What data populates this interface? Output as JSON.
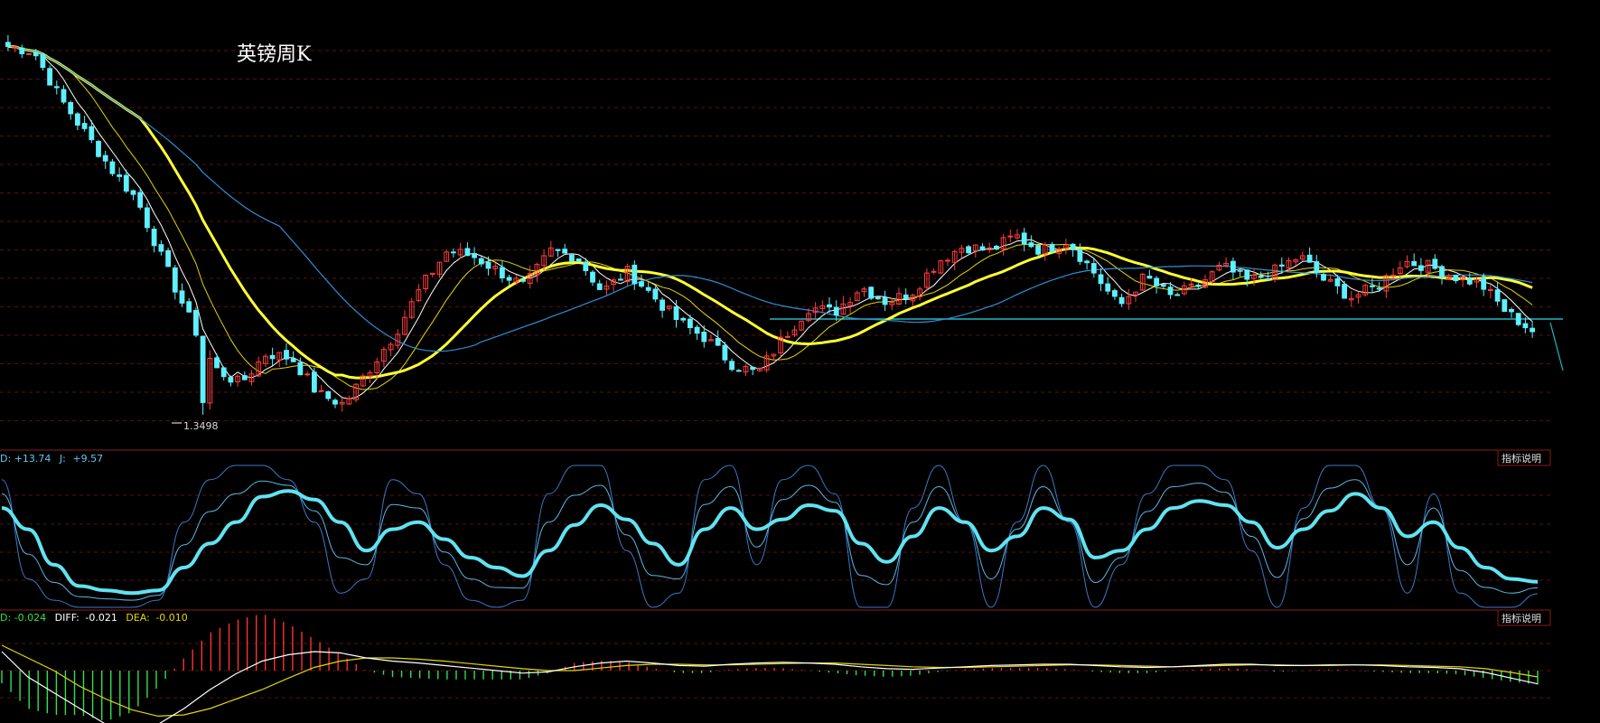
{
  "chart_title": "英镑周K",
  "low_marker": "1.3498",
  "colors": {
    "background": "#000000",
    "grid": "#5a0f0f",
    "panel_border": "#8b1b1b",
    "up": "#ff3d3d",
    "down": "#5ff0ff",
    "ma_white": "#ffffff",
    "ma_yellow_thin": "#e6d600",
    "ma_yellow_thick": "#ffff33",
    "ma_blue": "#2e8fd6",
    "support": "#20b7c6",
    "kdj_k": "#61e3f0",
    "kdj_d": "#5ab7e6",
    "kdj_j": "#3a79c4",
    "macd_diff": "#ffffff",
    "macd_dea": "#e6d600",
    "macd_pos": "#ff3030",
    "macd_neg": "#31e04d"
  },
  "kdj_header": {
    "d_label": "D:",
    "d_value": "+13.74",
    "j_label": "J:",
    "j_value": "+9.57"
  },
  "macd_header": {
    "macd_label": "D:",
    "macd_value": "-0.024",
    "diff_label": "DIFF:",
    "diff_value": "-0.021",
    "dea_label": "DEA:",
    "dea_value": "-0.010"
  },
  "buttons": {
    "kdj_explain": "指标说明",
    "macd_explain": "指标说明"
  },
  "chart_data": [
    {
      "type": "candlestick",
      "title": "英镑周K",
      "series_anchor_closes": [
        1.71,
        1.705,
        1.66,
        1.625,
        1.59,
        1.56,
        1.5,
        1.445,
        1.395,
        1.38,
        1.41,
        1.405,
        1.37,
        1.36,
        1.395,
        1.43,
        1.475,
        1.51,
        1.505,
        1.49,
        1.475,
        1.51,
        1.505,
        1.47,
        1.49,
        1.465,
        1.44,
        1.425,
        1.4,
        1.39,
        1.425,
        1.455,
        1.45,
        1.475,
        1.46,
        1.47,
        1.5,
        1.515,
        1.51,
        1.525,
        1.51,
        1.52,
        1.49,
        1.455,
        1.485,
        1.465,
        1.475,
        1.495,
        1.48,
        1.49,
        1.505,
        1.48,
        1.465,
        1.475,
        1.5,
        1.495,
        1.485,
        1.478,
        1.45,
        1.432
      ],
      "price_levels": {
        "low_marker": 1.3498,
        "support_line": 1.452
      },
      "moving_averages": [
        "white",
        "yellow-thin",
        "yellow-thick",
        "blue"
      ]
    },
    {
      "type": "line",
      "indicator": "KDJ",
      "series": [
        {
          "name": "D",
          "values": [
            70,
            55,
            30,
            15,
            12,
            10,
            12,
            28,
            45,
            60,
            78,
            82,
            76,
            60,
            40,
            55,
            60,
            48,
            35,
            28,
            22,
            40,
            58,
            72,
            62,
            45,
            30,
            55,
            70,
            55,
            62,
            72,
            68,
            45,
            32,
            50,
            70,
            60,
            40,
            50,
            70,
            62,
            35,
            40,
            55,
            70,
            75,
            72,
            60,
            42,
            55,
            68,
            80,
            70,
            50,
            60,
            42,
            28,
            20,
            18
          ]
        },
        {
          "name": "J",
          "values": [
            90,
            20,
            5,
            0,
            0,
            0,
            5,
            60,
            90,
            100,
            100,
            90,
            60,
            10,
            20,
            90,
            80,
            30,
            5,
            0,
            5,
            80,
            100,
            100,
            40,
            0,
            10,
            90,
            100,
            30,
            90,
            100,
            80,
            0,
            0,
            70,
            100,
            60,
            0,
            60,
            100,
            60,
            0,
            30,
            80,
            100,
            100,
            90,
            40,
            0,
            70,
            100,
            100,
            70,
            10,
            80,
            10,
            0,
            0,
            9.57
          ]
        }
      ]
    },
    {
      "type": "bar",
      "indicator": "MACD",
      "series": [
        {
          "name": "DIFF",
          "values": [
            0.03,
            -0.01,
            -0.035,
            -0.06,
            -0.085,
            -0.095,
            -0.085,
            -0.06,
            -0.03,
            -0.005,
            0.015,
            0.025,
            0.03,
            0.028,
            0.02,
            0.015,
            0.012,
            0.008,
            0.004,
            0.0,
            -0.004,
            -0.002,
            0.006,
            0.012,
            0.015,
            0.012,
            0.008,
            0.007,
            0.01,
            0.012,
            0.013,
            0.012,
            0.01,
            0.006,
            0.003,
            0.002,
            0.004,
            0.006,
            0.008,
            0.009,
            0.01,
            0.01,
            0.008,
            0.006,
            0.005,
            0.006,
            0.008,
            0.01,
            0.01,
            0.008,
            0.008,
            0.009,
            0.009,
            0.008,
            0.006,
            0.005,
            0.003,
            -0.003,
            -0.012,
            -0.021
          ]
        },
        {
          "name": "DEA",
          "values": [
            0.04,
            0.02,
            0.0,
            -0.025,
            -0.045,
            -0.062,
            -0.072,
            -0.07,
            -0.06,
            -0.045,
            -0.03,
            -0.012,
            0.005,
            0.015,
            0.02,
            0.02,
            0.018,
            0.015,
            0.011,
            0.007,
            0.003,
            0.0,
            0.0,
            0.004,
            0.008,
            0.01,
            0.01,
            0.009,
            0.009,
            0.01,
            0.011,
            0.012,
            0.012,
            0.01,
            0.008,
            0.006,
            0.005,
            0.005,
            0.006,
            0.007,
            0.008,
            0.009,
            0.009,
            0.008,
            0.007,
            0.006,
            0.007,
            0.008,
            0.009,
            0.009,
            0.008,
            0.008,
            0.009,
            0.009,
            0.008,
            0.007,
            0.006,
            0.003,
            -0.003,
            -0.01
          ]
        }
      ]
    }
  ]
}
